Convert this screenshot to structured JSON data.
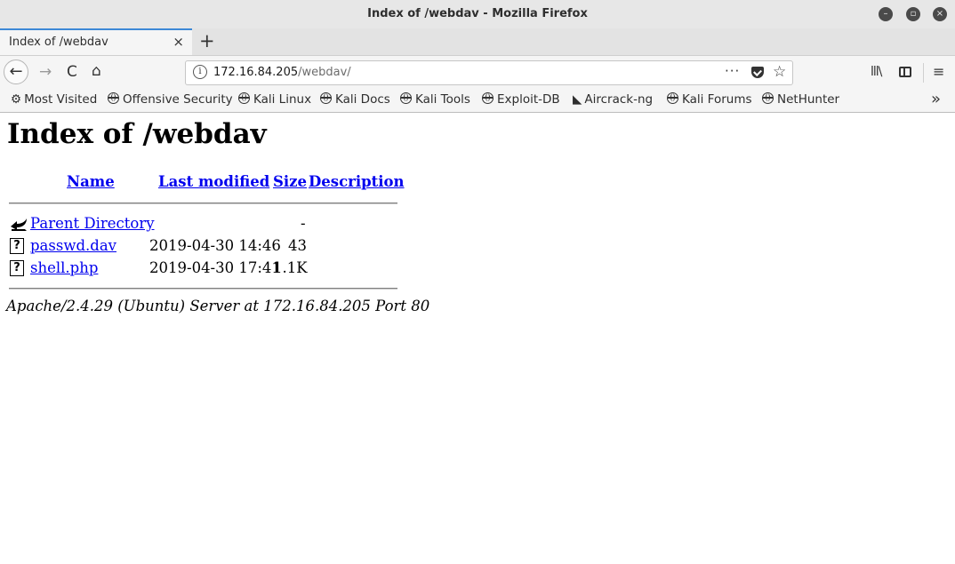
{
  "window": {
    "title": "Index of /webdav - Mozilla Firefox",
    "controls": [
      "minimize-icon",
      "maximize-icon",
      "close-icon"
    ]
  },
  "tab": {
    "label": "Index of /webdav",
    "close": "×",
    "new_tab": "+"
  },
  "nav": {
    "back": "←",
    "forward": "→",
    "reload": "C",
    "home": "⌂",
    "url_host": "172.16.84.205",
    "url_path": "/webdav/",
    "info": "i",
    "more": "···",
    "star": "☆",
    "library": "lll\\",
    "menu": "≡"
  },
  "bookmarks": {
    "items": [
      {
        "label": "Most Visited",
        "icon": "gear-icon"
      },
      {
        "label": "Offensive Security",
        "icon": "globe-icon"
      },
      {
        "label": "Kali Linux",
        "icon": "globe-icon"
      },
      {
        "label": "Kali Docs",
        "icon": "globe-icon"
      },
      {
        "label": "Kali Tools",
        "icon": "globe-icon"
      },
      {
        "label": "Exploit-DB",
        "icon": "globe-icon"
      },
      {
        "label": "Aircrack-ng",
        "icon": "aircrack-icon"
      },
      {
        "label": "Kali Forums",
        "icon": "globe-icon"
      },
      {
        "label": "NetHunter",
        "icon": "globe-icon"
      }
    ],
    "overflow": "»"
  },
  "page": {
    "heading": "Index of /webdav",
    "columns": {
      "name": "Name",
      "last_modified": "Last modified",
      "size": "Size",
      "description": "Description"
    },
    "rows": [
      {
        "name": "Parent Directory",
        "modified": "",
        "size": "-",
        "icon": "back-arrow-icon"
      },
      {
        "name": "passwd.dav",
        "modified": "2019-04-30 14:46",
        "size": "43",
        "icon": "unknown-file-icon"
      },
      {
        "name": "shell.php",
        "modified": "2019-04-30 17:41",
        "size": "1.1K",
        "icon": "unknown-file-icon"
      }
    ],
    "file_icon_glyph": "?",
    "server_signature": "Apache/2.4.29 (Ubuntu) Server at 172.16.84.205 Port 80"
  }
}
